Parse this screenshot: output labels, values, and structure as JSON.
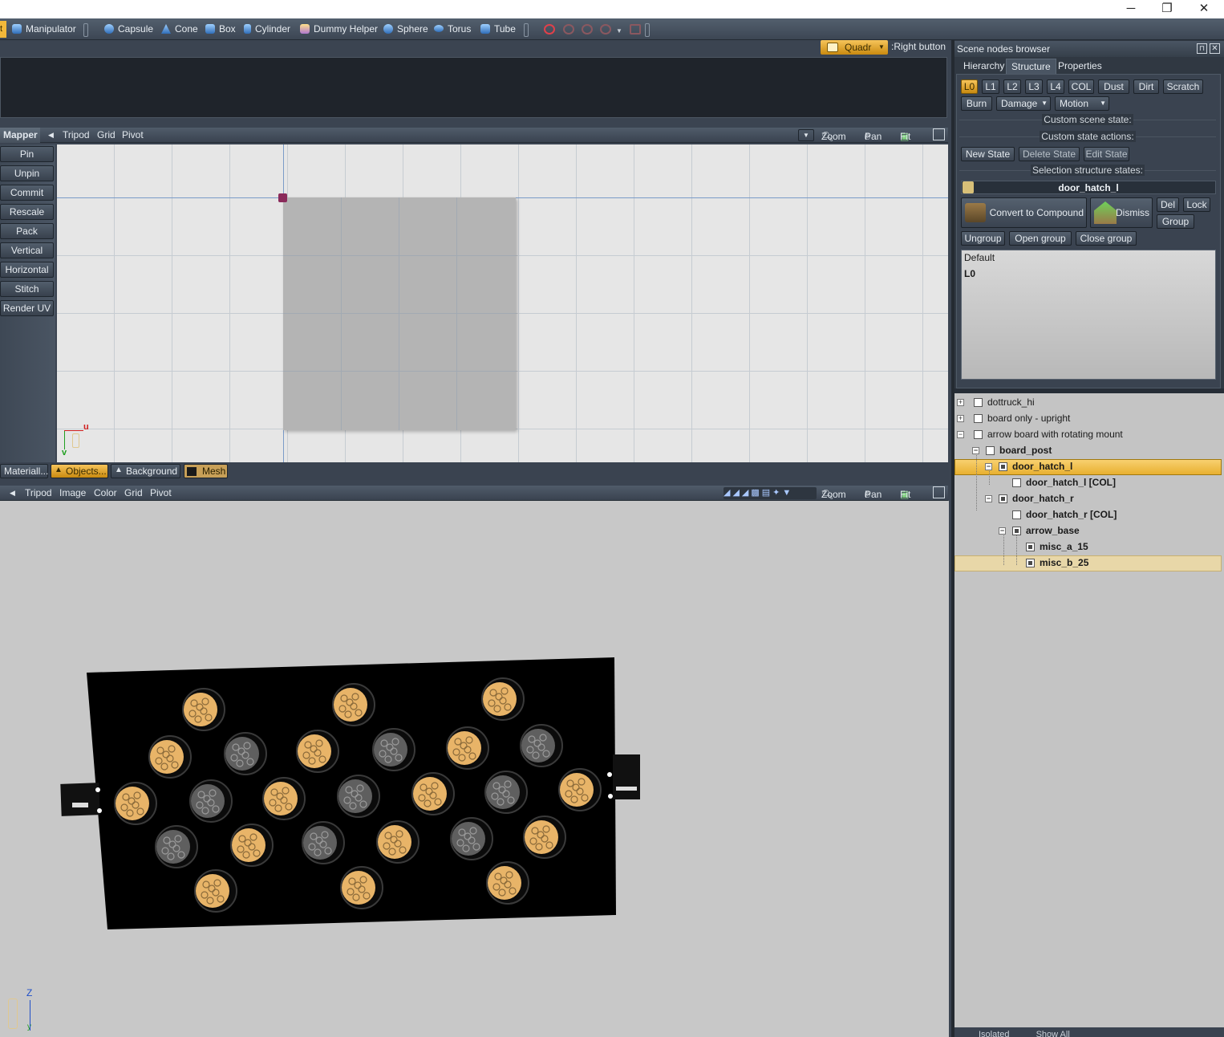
{
  "window": {
    "minimize": "─",
    "maximize": "❐",
    "close": "✕"
  },
  "toolbar": {
    "first": "t",
    "items": [
      "Manipulator",
      "Capsule",
      "Cone",
      "Box",
      "Cylinder",
      "Dummy Helper",
      "Sphere",
      "Torus",
      "Tube"
    ]
  },
  "viewport_top": {
    "mode": "Quadr",
    "right_button": ":Right button"
  },
  "uv_editor": {
    "title": "Mapper",
    "menu": [
      "Tripod",
      "Grid",
      "Pivot"
    ],
    "nav": {
      "zoom": "Zoom",
      "pan": "Pan",
      "fit": "Fit"
    },
    "axis_u": "u",
    "axis_v": "v",
    "side_buttons": [
      "Pin",
      "Unpin",
      "Commit",
      "Rescale",
      "Pack",
      "Vertical",
      "Horizontal",
      "Stitch",
      "Render UV"
    ],
    "tabs": [
      "Materiall...",
      "Objects...",
      "Background",
      "Mesh"
    ]
  },
  "viewport_3d": {
    "menu": [
      "Tripod",
      "Image",
      "Color",
      "Grid",
      "Pivot"
    ],
    "nav": {
      "zoom": "Zoom",
      "pan": "Pan",
      "fit": "Fit"
    },
    "axis_z": "Z",
    "axis_y": "y"
  },
  "scene_browser": {
    "title": "Scene nodes browser",
    "tabs": [
      "Hierarchy",
      "Structure",
      "Properties"
    ],
    "lod_buttons": [
      "L0",
      "L1",
      "L2",
      "L3",
      "L4",
      "COL",
      "Dust",
      "Dirt",
      "Scratch"
    ],
    "state_buttons": [
      "Burn",
      "Damage",
      "Motion"
    ],
    "custom_scene_state": "Custom scene state:",
    "custom_state_actions": "Custom state actions:",
    "state_actions": [
      "New State",
      "Delete State",
      "Edit State"
    ],
    "selection_states": "Selection structure states:",
    "selected_node": "door_hatch_l",
    "convert": "Convert to Compound",
    "dismiss": "Dismiss",
    "del": "Del",
    "lock": "Lock",
    "group": "Group",
    "group_actions": [
      "Ungroup",
      "Open group",
      "Close group"
    ],
    "state_list": [
      "Default",
      "L0"
    ],
    "bottom_bar": [
      "Isolated",
      "Show All"
    ]
  },
  "tree": [
    {
      "label": "dottruck_hi"
    },
    {
      "label": "board only - upright"
    },
    {
      "label": "arrow board with rotating mount"
    },
    {
      "label": "board_post"
    },
    {
      "label": "door_hatch_l"
    },
    {
      "label": "door_hatch_l [COL]"
    },
    {
      "label": "door_hatch_r"
    },
    {
      "label": "door_hatch_r [COL]"
    },
    {
      "label": "arrow_base"
    },
    {
      "label": "misc_a_15"
    },
    {
      "label": "misc_b_25"
    }
  ],
  "colors": {
    "accent": "#f2b83a",
    "selection": "#f5c860",
    "selection_soft": "#e8d7a8",
    "uv_background": "#e6e6e6",
    "viewport_background": "#c8c8c8",
    "board": "#000000",
    "lamp_lit": "#e8b468",
    "lamp_off": "#5f5f5f"
  }
}
